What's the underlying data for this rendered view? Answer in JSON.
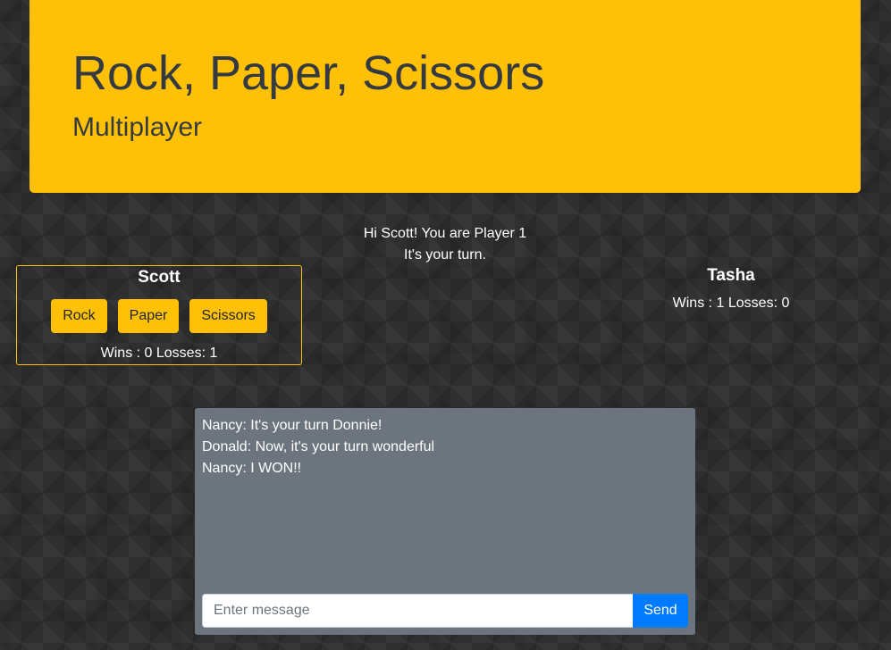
{
  "header": {
    "title": "Rock, Paper, Scissors",
    "subtitle": "Multiplayer"
  },
  "status": {
    "greeting": "Hi Scott! You are Player 1",
    "turn": "It's your turn."
  },
  "player": {
    "name": "Scott",
    "choices": [
      "Rock",
      "Paper",
      "Scissors"
    ],
    "record": "Wins : 0 Losses: 1"
  },
  "opponent": {
    "name": "Tasha",
    "record": "Wins : 1 Losses: 0"
  },
  "chat": {
    "messages": [
      "Nancy: It's your turn Donnie!",
      "Donald: Now, it's your turn wonderful",
      "Nancy: I WON!!"
    ],
    "placeholder": "Enter message",
    "send_label": "Send"
  },
  "colors": {
    "accent": "#ffc107",
    "send": "#007bff",
    "chat_bg": "#6c757d",
    "heading_text": "#343a40"
  }
}
